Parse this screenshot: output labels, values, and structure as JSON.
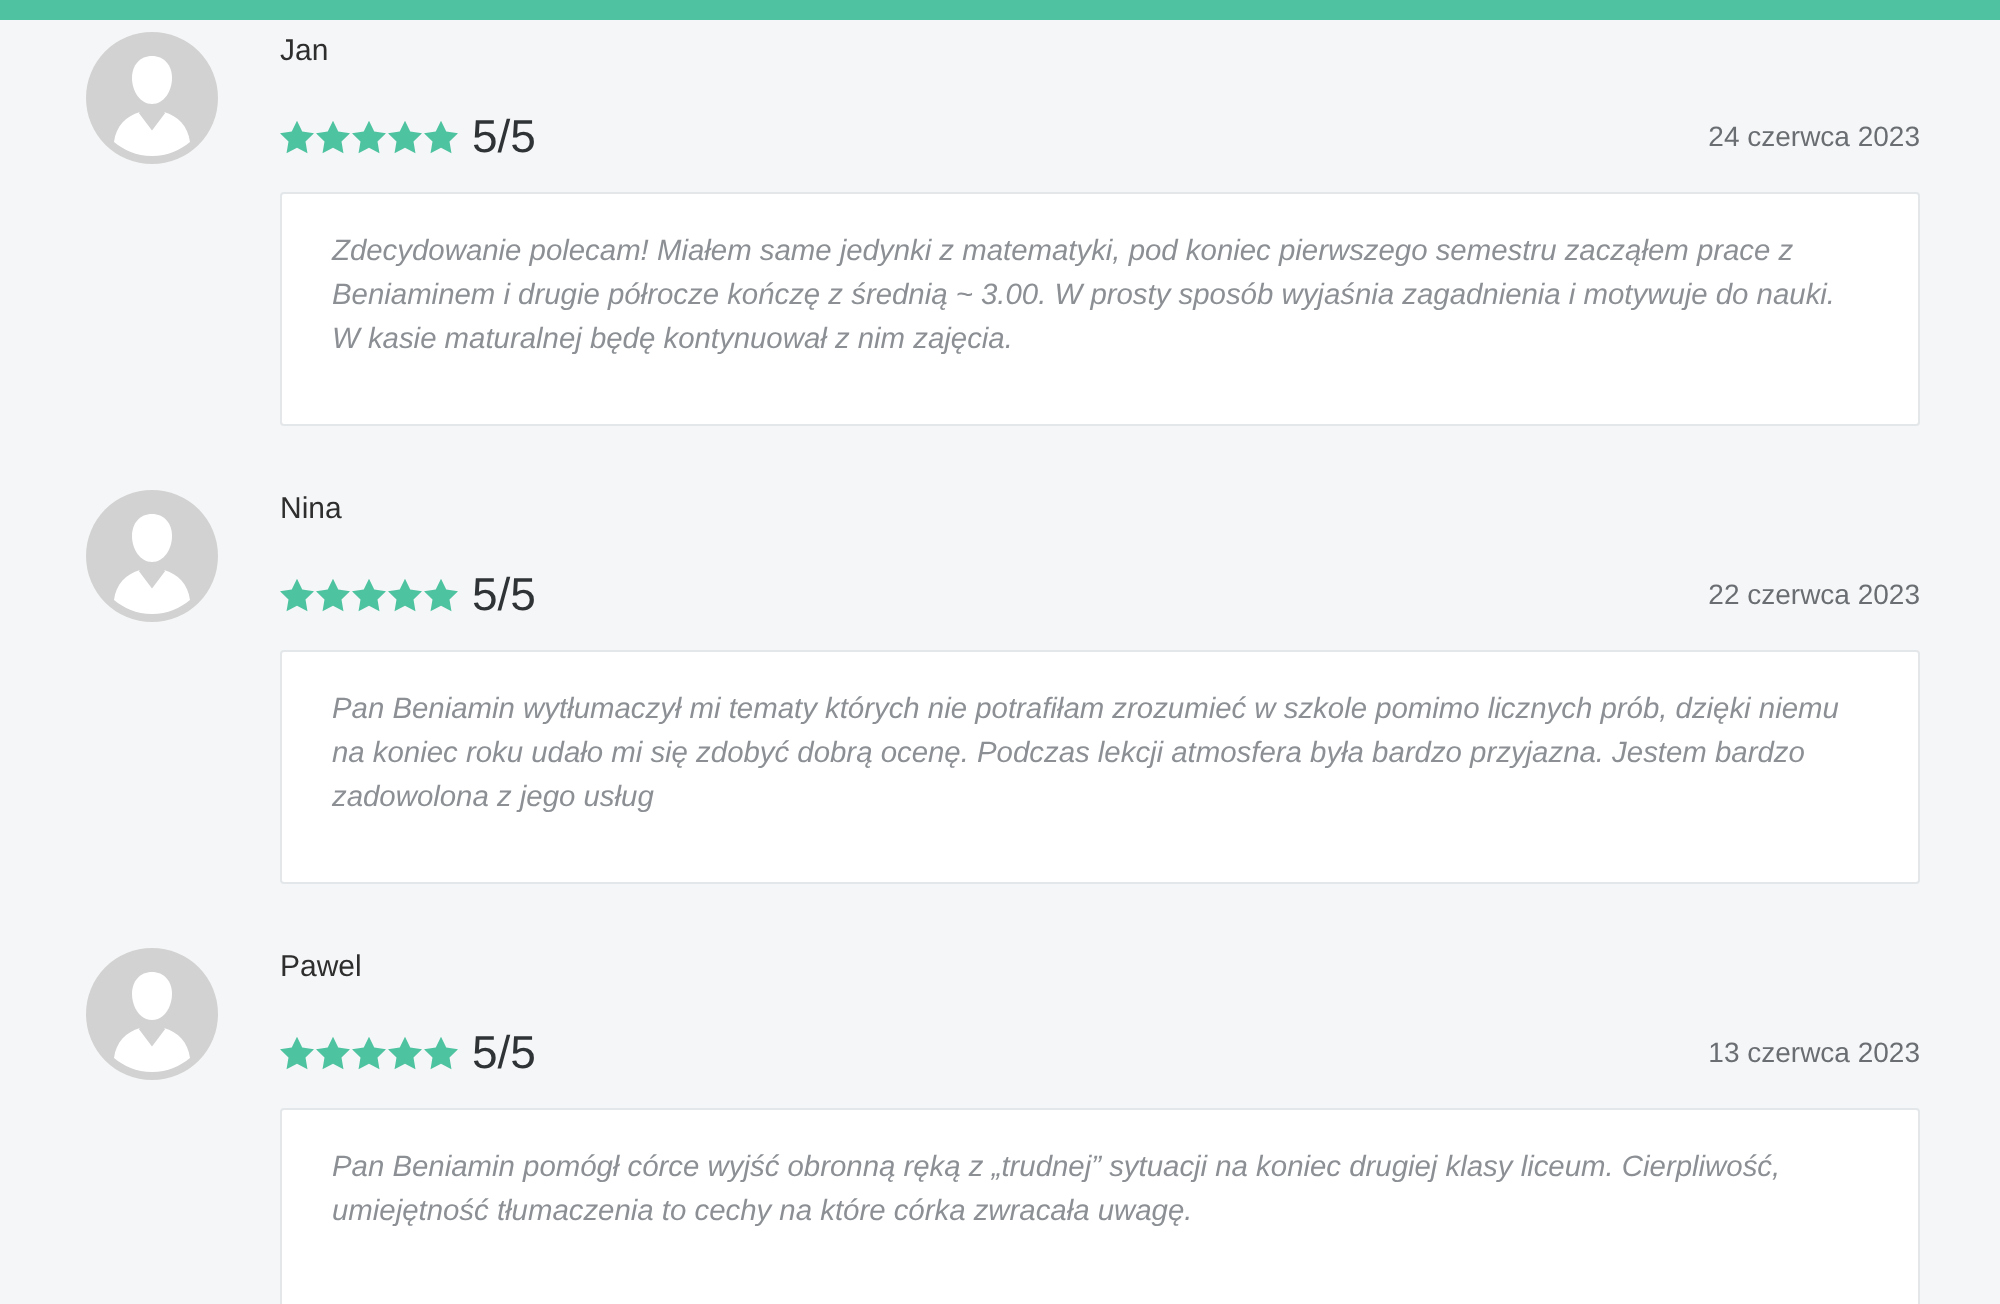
{
  "reviews": [
    {
      "author": "Jan",
      "stars": 5,
      "score": "5/5",
      "date": "24 czerwca 2023",
      "text": "Zdecydowanie polecam! Miałem same jedynki z matematyki, pod koniec pierwszego semestru zacząłem prace z Beniaminem i drugie półrocze kończę z średnią ~ 3.00. W prosty sposób wyjaśnia zagadnienia i motywuje do nauki. W kasie maturalnej będę kontynuował z nim zajęcia."
    },
    {
      "author": "Nina",
      "stars": 5,
      "score": "5/5",
      "date": "22 czerwca 2023",
      "text": "Pan Beniamin wytłumaczył mi tematy których nie potrafiłam zrozumieć w szkole pomimo licznych prób, dzięki niemu na koniec roku udało mi się zdobyć dobrą ocenę. Podczas lekcji atmosfera była bardzo przyjazna. Jestem bardzo zadowolona z jego usług"
    },
    {
      "author": "Pawel",
      "stars": 5,
      "score": "5/5",
      "date": "13 czerwca 2023",
      "text": "Pan Beniamin pomógł córce wyjść obronną ręką z „trudnej” sytuacji na koniec drugiej klasy liceum. Cierpliwość, umiejętność tłumaczenia to cechy na które córka zwracała uwagę."
    }
  ]
}
